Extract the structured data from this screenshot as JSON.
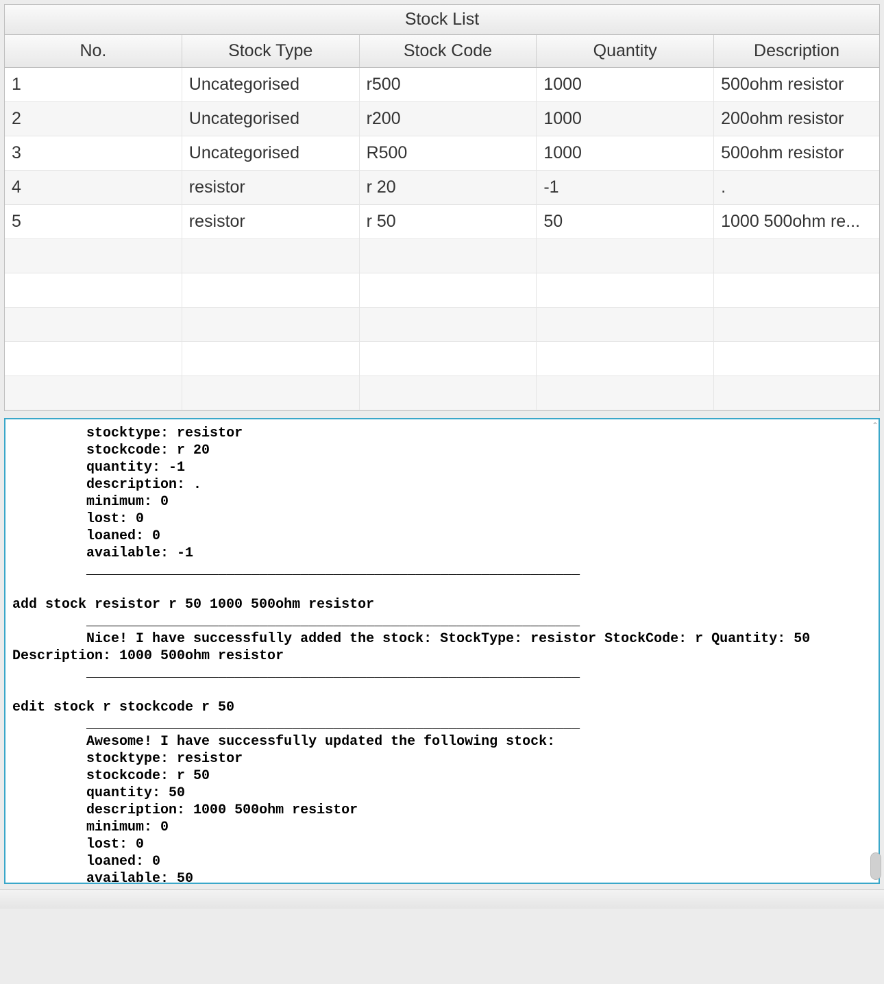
{
  "table": {
    "title": "Stock List",
    "headers": [
      "No.",
      "Stock Type",
      "Stock Code",
      "Quantity",
      "Description"
    ],
    "rows": [
      {
        "no": "1",
        "type": "Uncategorised",
        "code": "r500",
        "qty": "1000",
        "desc": "500ohm resistor"
      },
      {
        "no": "2",
        "type": "Uncategorised",
        "code": "r200",
        "qty": "1000",
        "desc": "200ohm resistor"
      },
      {
        "no": "3",
        "type": "Uncategorised",
        "code": "R500",
        "qty": "1000",
        "desc": "500ohm resistor"
      },
      {
        "no": "4",
        "type": "resistor",
        "code": "r 20",
        "qty": "-1",
        "desc": "."
      },
      {
        "no": "5",
        "type": "resistor",
        "code": "r 50",
        "qty": "50",
        "desc": "1000 500ohm re..."
      }
    ],
    "empty_rows": 5
  },
  "console": {
    "text": "         stocktype: resistor\n         stockcode: r 20\n         quantity: -1\n         description: .\n         minimum: 0\n         lost: 0\n         loaned: 0\n         available: -1\n         ____________________________________________________________\n\nadd stock resistor r 50 1000 500ohm resistor\n         ____________________________________________________________\n         Nice! I have successfully added the stock: StockType: resistor StockCode: r Quantity: 50\nDescription: 1000 500ohm resistor\n         ____________________________________________________________\n\nedit stock r stockcode r 50\n         ____________________________________________________________\n         Awesome! I have successfully updated the following stock:\n         stocktype: resistor\n         stockcode: r 50\n         quantity: 50\n         description: 1000 500ohm resistor\n         minimum: 0\n         lost: 0\n         loaned: 0\n         available: 50\n         ____________________________________________________________\n"
  }
}
